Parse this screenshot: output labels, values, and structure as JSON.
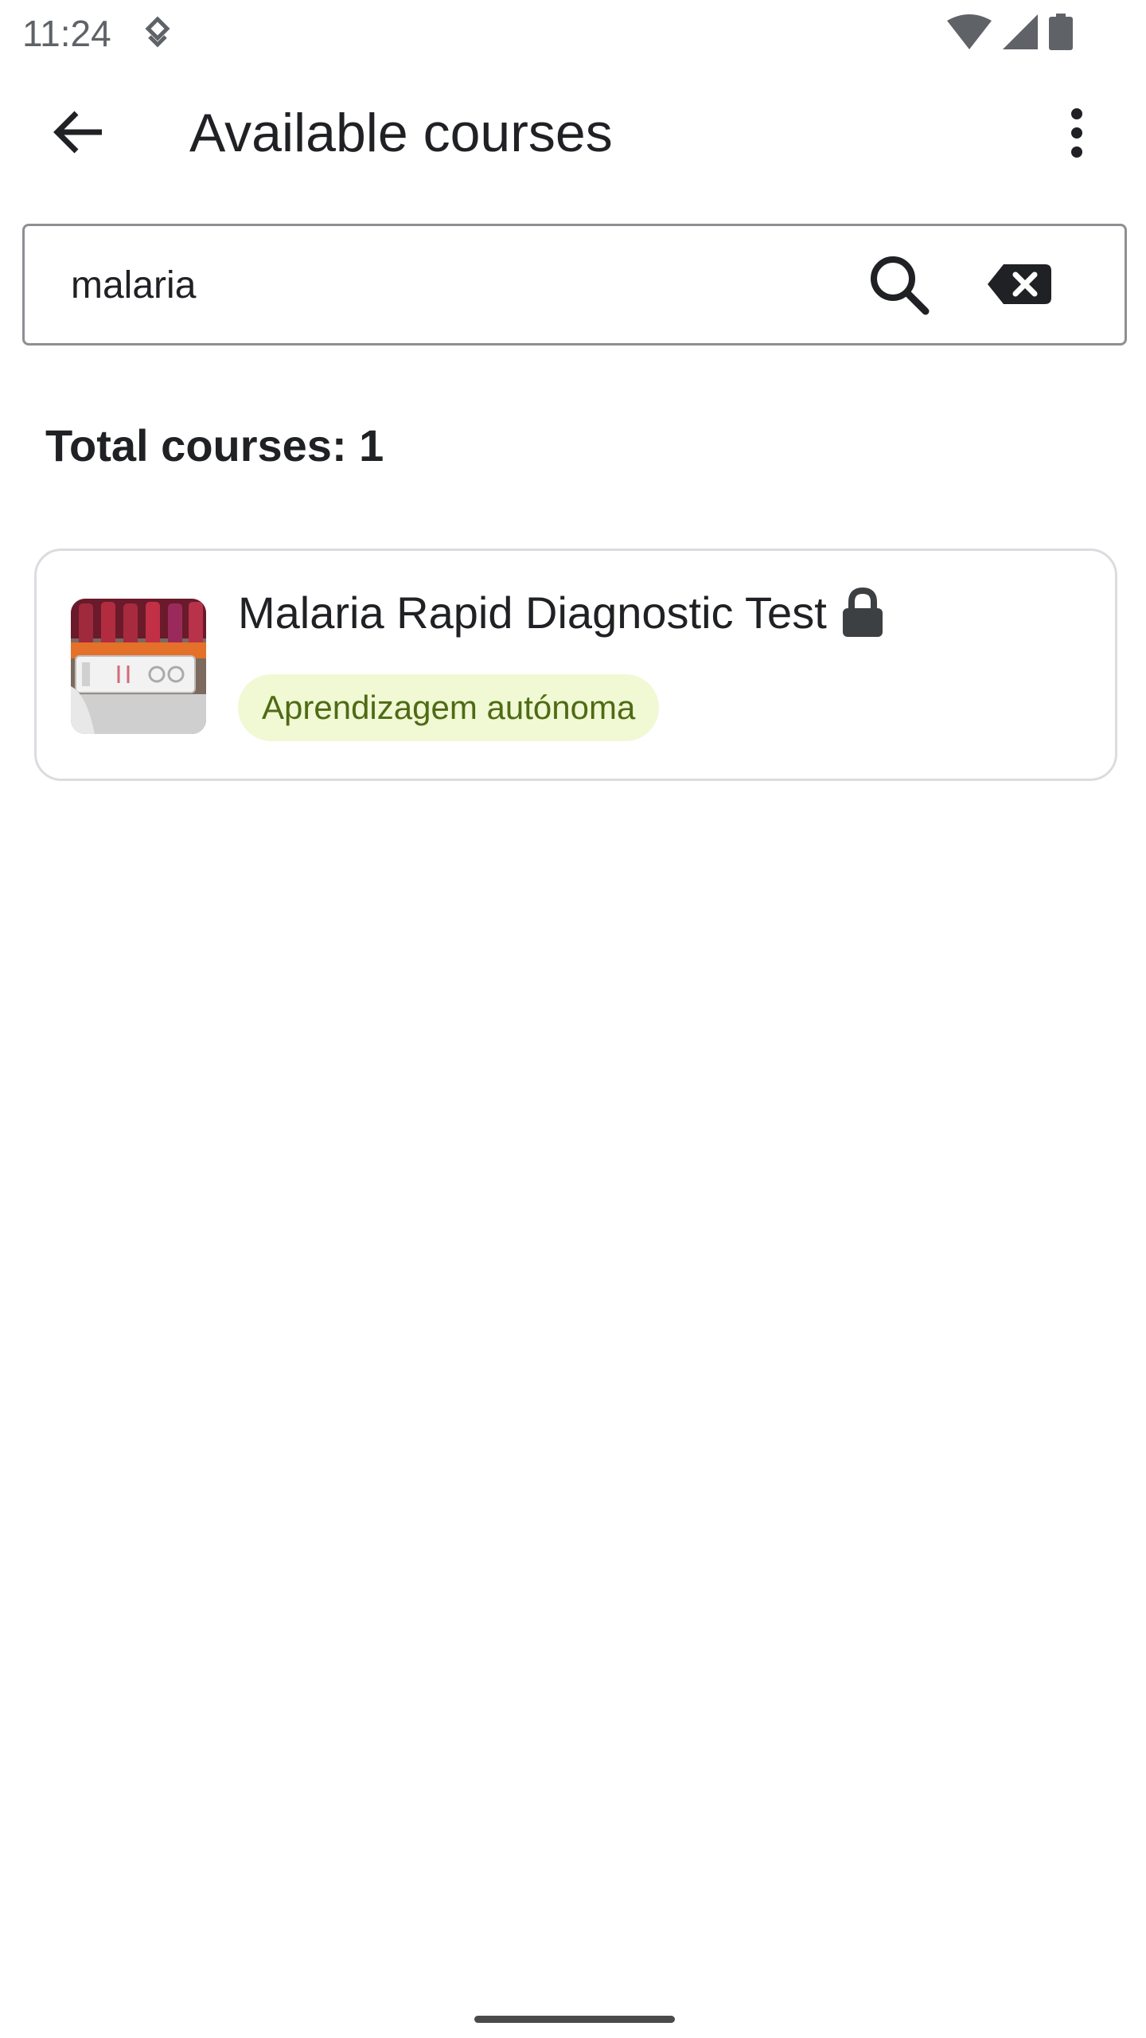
{
  "status_bar": {
    "time": "11:24"
  },
  "app_bar": {
    "title": "Available courses"
  },
  "search": {
    "value": "malaria",
    "placeholder": ""
  },
  "results": {
    "total_label": "Total courses: 1"
  },
  "courses": [
    {
      "title": "Malaria Rapid Diagnostic Test",
      "badge": "Aprendizagem autónoma",
      "locked": true
    }
  ],
  "colors": {
    "badge_bg": "#f1f8d4",
    "badge_text": "#4e6b14",
    "card_border": "#dadce0",
    "search_border": "#8e8e93"
  },
  "icons": {
    "back": "arrow-back-icon",
    "overflow": "more-vert-icon",
    "search": "search-icon",
    "clear": "backspace-clear-icon",
    "lock": "lock-icon"
  }
}
